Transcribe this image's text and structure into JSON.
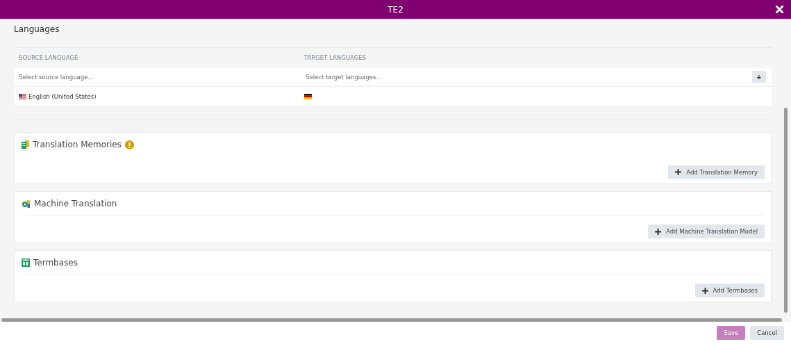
{
  "window": {
    "title": "TE2"
  },
  "languages": {
    "heading": "Languages",
    "columns": [
      "SOURCE LANGUAGE",
      "TARGET LANGUAGES"
    ],
    "source_placeholder": "Select source language...",
    "target_placeholder": "Select target languages...",
    "add_button": "+",
    "source": {
      "kind": "us",
      "label": "English (United States)"
    },
    "targets": [
      {
        "kind": "de"
      }
    ]
  },
  "sections": [
    {
      "kind": "memory",
      "title": "Translation Memories",
      "warning": true,
      "separator": false,
      "button": "Add Translation Memory"
    },
    {
      "kind": "machine",
      "title": "Machine Translation",
      "warning": false,
      "separator": true,
      "button": "Add Machine Translation Model"
    },
    {
      "kind": "termbase",
      "title": "Termbases",
      "warning": false,
      "separator": true,
      "button": "Add Termbases"
    }
  ],
  "footer": {
    "buttons": [
      {
        "label": "Save",
        "disabled": true
      },
      {
        "label": "Cancel",
        "disabled": false
      }
    ]
  }
}
